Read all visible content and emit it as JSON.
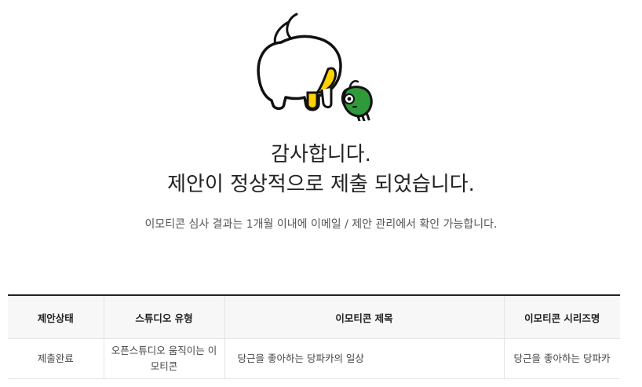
{
  "completion": {
    "illustration_icon": "character-illustration",
    "title_line1": "감사합니다.",
    "title_line2": "제안이 정상적으로 제출 되었습니다.",
    "subtitle": "이모티콘 심사 결과는 1개월 이내에 이메일 / 제안 관리에서 확인 가능합니다."
  },
  "table": {
    "headers": [
      "제안상태",
      "스튜디오 유형",
      "이모티콘 제목",
      "이모티콘 시리즈명"
    ],
    "rows": [
      {
        "status": "제출완료",
        "studio_type": "오픈스튜디오 움직이는 이모티콘",
        "title": "당근을 좋아하는 당파카의 일상",
        "series": "당근을 좋아하는 당파카"
      }
    ]
  },
  "colors": {
    "accent_yellow": "#FFD200",
    "character_green": "#2E9A3A",
    "outline": "#111111"
  }
}
